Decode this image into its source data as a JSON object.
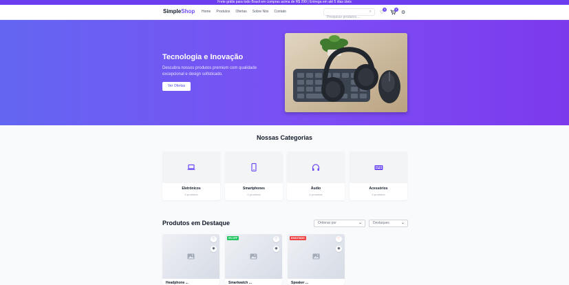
{
  "promo": {
    "text": "Frete grátis para todo Brasil em compras acima de R$ 299 | Entrega em até 5 dias úteis"
  },
  "header": {
    "logo_primary": "Simple",
    "logo_accent": "Shop",
    "nav": [
      "Home",
      "Produtos",
      "Ofertas",
      "Sobre Nós",
      "Contato"
    ],
    "search_placeholder": "Pesquisar produtos...",
    "wishlist_count": "0",
    "cart_count": "0"
  },
  "hero": {
    "title": "Tecnologia e Inovação",
    "subtitle": "Descubra nossos produtos premium com qualidade excepcional e design sofisticado.",
    "cta": "Ver Ofertas"
  },
  "categories": {
    "title": "Nossas Categorias",
    "items": [
      {
        "name": "Eletrônicos",
        "count": "0 produtos",
        "icon": "laptop-icon"
      },
      {
        "name": "Smartphones",
        "count": "0 produtos",
        "icon": "smartphone-icon"
      },
      {
        "name": "Áudio",
        "count": "0 produtos",
        "icon": "headphones-icon"
      },
      {
        "name": "Acessórios",
        "count": "0 produtos",
        "icon": "keyboard-icon"
      }
    ]
  },
  "featured": {
    "title": "Produtos em Destaque",
    "sort_label": "Ordenar por",
    "filter_label": "Destaques",
    "products": [
      {
        "name": "Headphone ...",
        "badge": ""
      },
      {
        "name": "Smartwatch ...",
        "badge": "5% OFF"
      },
      {
        "name": "Speaker ...",
        "badge": "ESGOTADO"
      }
    ]
  },
  "colors": {
    "accent": "#6d4af5",
    "hero_start": "#6366f1",
    "hero_end": "#7c3aed",
    "sale": "#22c55e",
    "soldout": "#ef4444"
  }
}
